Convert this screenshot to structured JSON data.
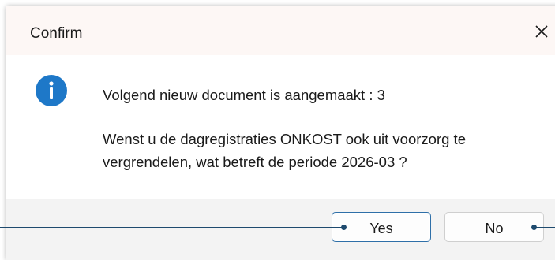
{
  "dialog": {
    "title": "Confirm",
    "message_line1": "Volgend nieuw document is aangemaakt : 3",
    "message_line2": "Wenst u de dagregistraties ONKOST ook uit voorzorg te vergrendelen, wat betreft de periode 2026-03 ?",
    "icon": "info-icon",
    "close_icon": "close-icon"
  },
  "buttons": {
    "yes_label": "Yes",
    "no_label": "No"
  },
  "colors": {
    "title_bar": "#fdf7f5",
    "footer": "#f3f3f3",
    "info_icon": "#1e78c8",
    "default_button_border": "#2e6fa8",
    "annotation_line": "#1e4a6e"
  }
}
